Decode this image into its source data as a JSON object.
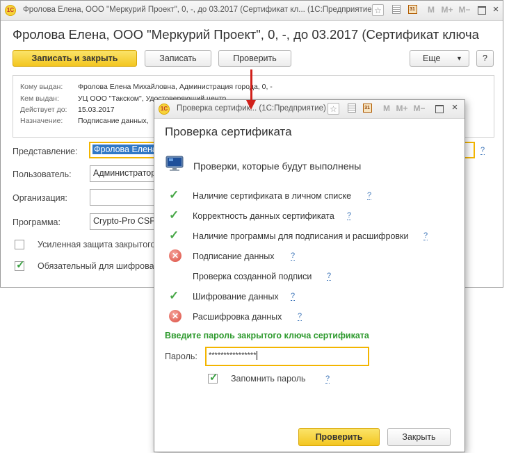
{
  "main_window": {
    "title": "Фролова Елена, ООО \"Меркурий Проект\", 0, -, до 03.2017 (Сертификат кл... (1С:Предприятие)",
    "heading": "Фролова Елена, ООО \"Меркурий Проект\", 0, -, до 03.2017 (Сертификат ключа",
    "toolbar": {
      "save_close_label": "Записать и закрыть",
      "save_label": "Записать",
      "check_label": "Проверить",
      "more_label": "Еще",
      "help_label": "?"
    },
    "info": {
      "issued_to_label": "Кому выдан:",
      "issued_to_value": "Фролова Елена Михайловна, Администрация города, 0, -",
      "issued_by_label": "Кем выдан:",
      "issued_by_value": "УЦ ООО \"Такском\", Удостоверяющий центр",
      "valid_until_label": "Действует до:",
      "valid_until_value": "15.03.2017",
      "purpose_label": "Назначение:",
      "purpose_value": "Подписание данных,"
    },
    "fields": {
      "representation_label": "Представление:",
      "representation_value": "Фролова Елена",
      "user_label": "Пользователь:",
      "user_value": "Администратор",
      "organization_label": "Организация:",
      "organization_value": "",
      "program_label": "Программа:",
      "program_value": "Crypto-Pro CSP"
    },
    "checkboxes": {
      "strong_protection_label": "Усиленная защита закрытого",
      "encryption_required_label": "Обязательный для шифрова"
    }
  },
  "dialog": {
    "title": "Проверка сертифик... (1С:Предприятие)",
    "heading": "Проверка сертификата",
    "subheading": "Проверки, которые будут выполнены",
    "checks": [
      {
        "label": "Наличие сертификата в личном списке",
        "status": "ok",
        "help": "?"
      },
      {
        "label": "Корректность данных сертификата",
        "status": "ok",
        "help": "?"
      },
      {
        "label": "Наличие программы для подписания и расшифровки",
        "status": "ok",
        "help": "?"
      },
      {
        "label": "Подписание данных",
        "status": "error",
        "help": "?"
      },
      {
        "label": "Проверка созданной подписи",
        "status": "none",
        "help": "?"
      },
      {
        "label": "Шифрование данных",
        "status": "ok",
        "help": "?"
      },
      {
        "label": "Расшифровка данных",
        "status": "error",
        "help": "?"
      }
    ],
    "password_prompt": "Введите пароль закрытого ключа сертификата",
    "password_label": "Пароль:",
    "password_value": "****************",
    "remember_label": "Запомнить пароль",
    "remember_help": "?",
    "check_button": "Проверить",
    "close_button": "Закрыть"
  },
  "window_controls": {
    "icons": [
      "star-icon",
      "grid-icon",
      "calendar-icon",
      "m-icon",
      "m-plus-icon",
      "m-minus-icon",
      "restore-icon",
      "close-icon"
    ],
    "m": "M",
    "m_plus": "M+",
    "m_minus": "M−",
    "calendar_day": "31",
    "close": "×"
  },
  "colors": {
    "accent_yellow": "#f3c620",
    "focus_border": "#f3b500",
    "ok_green": "#4aa84a",
    "error_red": "#d9483b",
    "prompt_green": "#2e9a2e",
    "arrow_red": "#d0201a",
    "link_blue": "#3c74b8"
  }
}
